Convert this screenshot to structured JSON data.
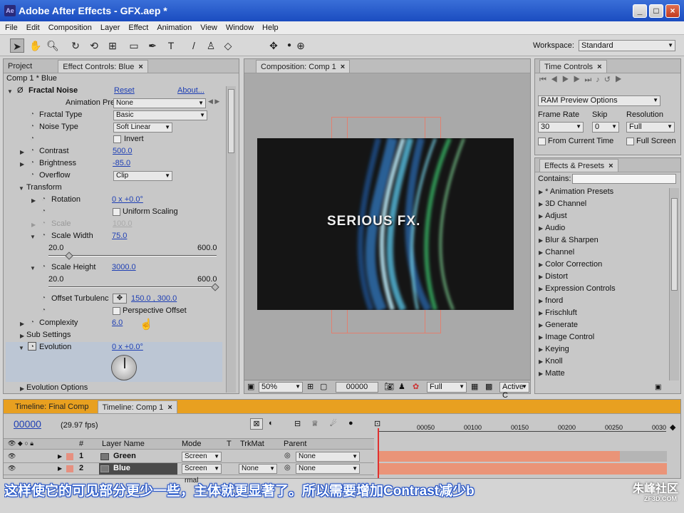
{
  "window": {
    "title": "Adobe After Effects - GFX.aep *",
    "app_icon": "Ae"
  },
  "menu": [
    "File",
    "Edit",
    "Composition",
    "Layer",
    "Effect",
    "Animation",
    "View",
    "Window",
    "Help"
  ],
  "toolbar": {
    "workspace_label": "Workspace:",
    "workspace_value": "Standard"
  },
  "project_panel": {
    "tab_project": "Project",
    "tab_effect": "Effect Controls: Blue",
    "breadcrumb": "Comp 1 * Blue",
    "effect": {
      "name": "Fractal Noise",
      "reset": "Reset",
      "about": "About...",
      "animation_presets_label": "Animation Presets:",
      "animation_presets_value": "None",
      "fractal_type_label": "Fractal Type",
      "fractal_type_value": "Basic",
      "noise_type_label": "Noise Type",
      "noise_type_value": "Soft Linear",
      "invert_label": "Invert",
      "contrast_label": "Contrast",
      "contrast_value": "500.0",
      "brightness_label": "Brightness",
      "brightness_value": "-85.0",
      "overflow_label": "Overflow",
      "overflow_value": "Clip",
      "transform_label": "Transform",
      "rotation_label": "Rotation",
      "rotation_value": "0 x +0.0°",
      "uniform_scaling_label": "Uniform Scaling",
      "scale_label": "Scale",
      "scale_value": "100.0",
      "scale_width_label": "Scale Width",
      "scale_width_value": "75.0",
      "scale_width_min": "20.0",
      "scale_width_max": "600.0",
      "scale_height_label": "Scale Height",
      "scale_height_value": "3000.0",
      "scale_height_min": "20.0",
      "scale_height_max": "600.0",
      "offset_label": "Offset Turbulenc",
      "offset_value": "150.0 , 300.0",
      "perspective_label": "Perspective Offset",
      "complexity_label": "Complexity",
      "complexity_value": "6.0",
      "sub_settings_label": "Sub Settings",
      "evolution_label": "Evolution",
      "evolution_value": "0 x +0.0°",
      "evolution_options_label": "Evolution Options"
    }
  },
  "composition": {
    "tab": "Composition: Comp 1",
    "preview_text": "SERIOUS FX.",
    "zoom": "50%",
    "timecode": "00000",
    "quality": "Full",
    "view": "Active C"
  },
  "time_controls": {
    "tab": "Time Controls",
    "ram_preview": "RAM Preview Options",
    "frame_rate_label": "Frame Rate",
    "frame_rate_value": "30",
    "skip_label": "Skip",
    "skip_value": "0",
    "resolution_label": "Resolution",
    "resolution_value": "Full",
    "from_current": "From Current Time",
    "full_screen": "Full Screen"
  },
  "effects_presets": {
    "tab": "Effects & Presets",
    "contains_label": "Contains:",
    "items": [
      "* Animation Presets",
      "3D Channel",
      "Adjust",
      "Audio",
      "Blur & Sharpen",
      "Channel",
      "Color Correction",
      "Distort",
      "Expression Controls",
      "fnord",
      "Frischluft",
      "Generate",
      "Image Control",
      "Keying",
      "Knoll",
      "Matte"
    ]
  },
  "timeline": {
    "tab_final": "Timeline: Final Comp",
    "tab_comp": "Timeline: Comp 1",
    "timecode": "00000",
    "fps": "(29.97 fps)",
    "col_hash": "#",
    "col_layer": "Layer Name",
    "col_mode": "Mode",
    "col_t": "T",
    "col_trkmat": "TrkMat",
    "col_parent": "Parent",
    "ruler": [
      "00050",
      "00100",
      "00150",
      "00200",
      "00250",
      "0030"
    ],
    "layers": [
      {
        "num": "1",
        "name": "Green",
        "mode": "Screen",
        "trkmat": "",
        "parent": "None"
      },
      {
        "num": "2",
        "name": "Blue",
        "mode": "Screen",
        "trkmat": "None",
        "parent": "None"
      }
    ],
    "row3_mode": "rmal"
  },
  "subtitle": "这样使它的可见部分更少一些，主体就更显著了。所以需要增加Contrast减少b",
  "watermark": "朱峰社区",
  "watermark_sub": "ZF3D.COM"
}
